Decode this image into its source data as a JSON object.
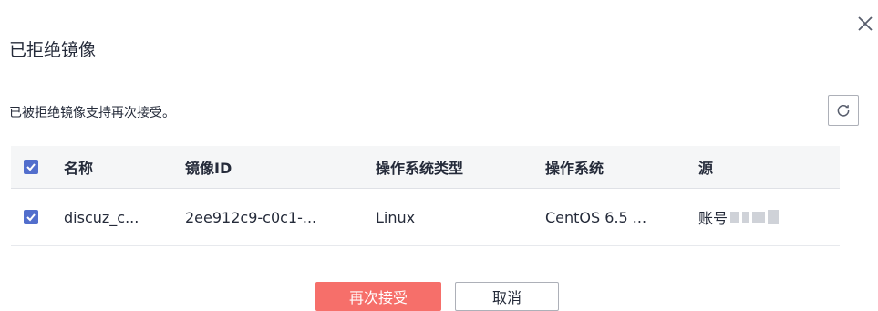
{
  "dialog": {
    "title": "已拒绝镜像",
    "description": "已被拒绝镜像支持再次接受。"
  },
  "table": {
    "columns": [
      "名称",
      "镜像ID",
      "操作系统类型",
      "操作系统",
      "源"
    ],
    "rows": [
      {
        "name": "discuz_c...",
        "image_id": "2ee912c9-c0c1-...",
        "os_type": "Linux",
        "os": "CentOS 6.5 ...",
        "source": "账号"
      }
    ]
  },
  "buttons": {
    "accept": "再次接受",
    "cancel": "取消"
  },
  "colors": {
    "primary_danger": "#f66f6a",
    "checkbox": "#526ecc",
    "header_bg": "#f5f6f7"
  },
  "icons": {
    "close": "close-icon",
    "refresh": "refresh-icon",
    "checkbox": "checkbox-checked-icon"
  }
}
